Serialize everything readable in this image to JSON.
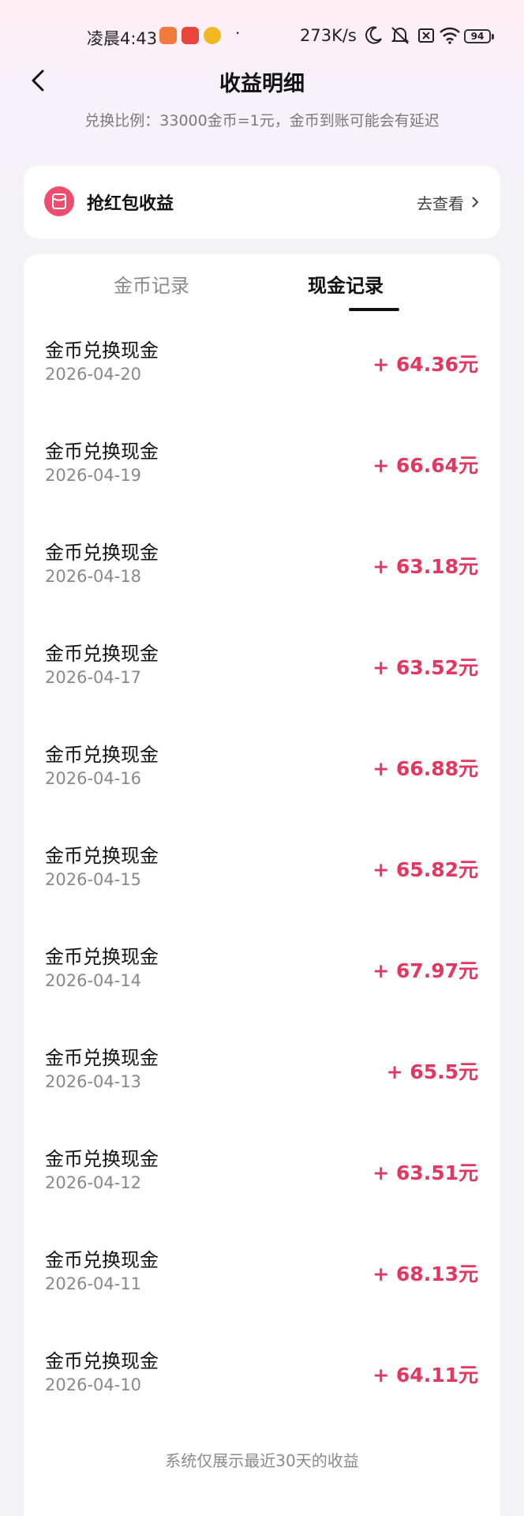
{
  "status_bar": {
    "time": "凌晨4:43",
    "dot": "·",
    "net_speed": "273K/s",
    "battery": "94"
  },
  "header": {
    "title": "收益明细",
    "subtitle": "兑换比例：33000金币=1元，金币到账可能会有延迟"
  },
  "red_packet": {
    "label": "抢红包收益",
    "link": "去查看"
  },
  "tabs": {
    "coin": "金币记录",
    "cash": "现金记录"
  },
  "records": [
    {
      "title": "金币兑换现金",
      "date": "2026-04-20",
      "amount": "+ 64.36元"
    },
    {
      "title": "金币兑换现金",
      "date": "2026-04-19",
      "amount": "+ 66.64元"
    },
    {
      "title": "金币兑换现金",
      "date": "2026-04-18",
      "amount": "+ 63.18元"
    },
    {
      "title": "金币兑换现金",
      "date": "2026-04-17",
      "amount": "+ 63.52元"
    },
    {
      "title": "金币兑换现金",
      "date": "2026-04-16",
      "amount": "+ 66.88元"
    },
    {
      "title": "金币兑换现金",
      "date": "2026-04-15",
      "amount": "+ 65.82元"
    },
    {
      "title": "金币兑换现金",
      "date": "2026-04-14",
      "amount": "+ 67.97元"
    },
    {
      "title": "金币兑换现金",
      "date": "2026-04-13",
      "amount": "+ 65.5元"
    },
    {
      "title": "金币兑换现金",
      "date": "2026-04-12",
      "amount": "+ 63.51元"
    },
    {
      "title": "金币兑换现金",
      "date": "2026-04-11",
      "amount": "+ 68.13元"
    },
    {
      "title": "金币兑换现金",
      "date": "2026-04-10",
      "amount": "+ 64.11元"
    }
  ],
  "footer": "系统仅展示最近30天的收益",
  "colors": {
    "accent": "#e3375f",
    "red_packet_icon": "#ef4d6f"
  }
}
